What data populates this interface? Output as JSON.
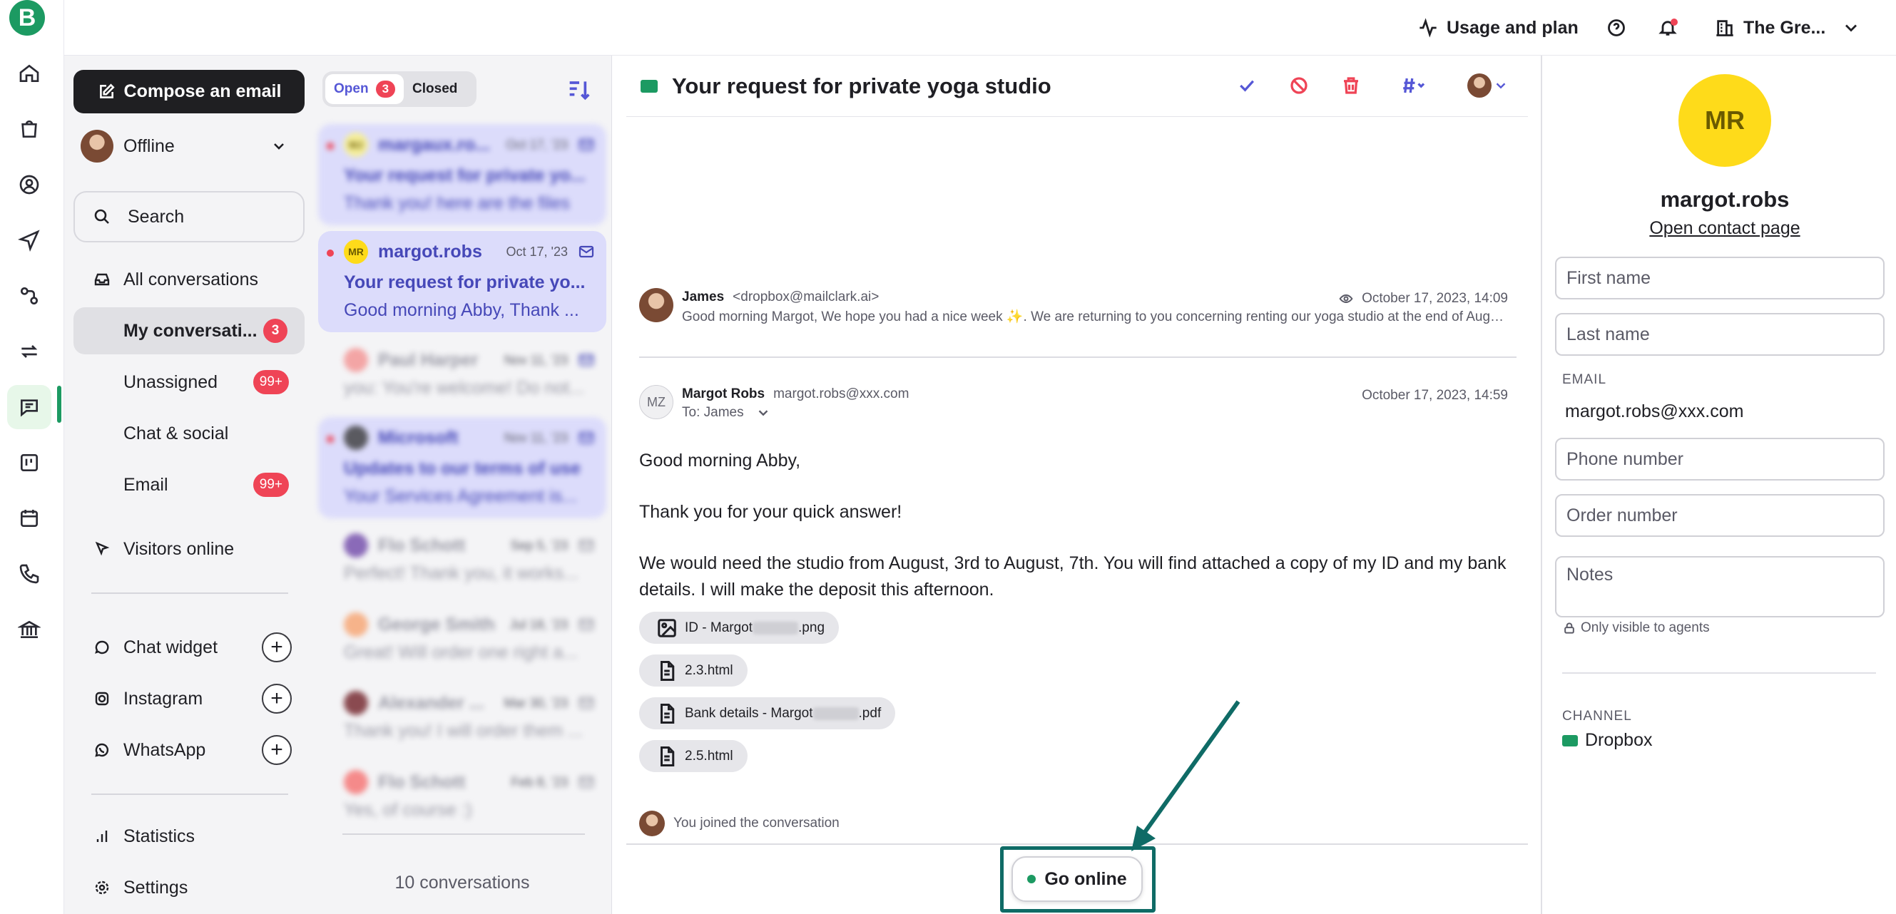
{
  "header": {
    "usage": "Usage and plan",
    "workspace": "The Gre..."
  },
  "leftnav": {
    "compose": "Compose an email",
    "status": "Offline",
    "search": "Search",
    "all": "All conversations",
    "mine": "My conversati...",
    "mine_count": "3",
    "unassigned": "Unassigned",
    "unassigned_count": "99+",
    "chat_social": "Chat & social",
    "email": "Email",
    "email_count": "99+",
    "visitors": "Visitors online",
    "chat_widget": "Chat widget",
    "instagram": "Instagram",
    "whatsapp": "WhatsApp",
    "statistics": "Statistics",
    "settings": "Settings",
    "plus": "+"
  },
  "convlist": {
    "tab_open": "Open",
    "tab_open_count": "3",
    "tab_closed": "Closed",
    "footer": "10 conversations",
    "items": [
      {
        "av": "MJ",
        "name": "margaux.ro...",
        "date": "Oct 17, '23",
        "subject": "Your request for private yo...",
        "preview": "Thank you! here are the files",
        "avcolor": "#f6ef9a"
      },
      {
        "av": "MR",
        "name": "margot.robs",
        "date": "Oct 17, '23",
        "subject": "Your request for private yo...",
        "preview": "Good morning Abby, Thank ...",
        "avcolor": "#fedb1a"
      },
      {
        "av": "",
        "name": "Paul Harper",
        "date": "Nov 11, '23",
        "subject": "",
        "preview": "you: You're welcome! Do not...",
        "avcolor": "#f3a5a5"
      },
      {
        "av": "",
        "name": "Microsoft",
        "date": "Nov 11, '23",
        "subject": "Updates to our terms of use",
        "preview": "Your Services Agreement is...",
        "avcolor": "#5a5a60"
      },
      {
        "av": "",
        "name": "Flo Schott",
        "date": "Sep 5, '23",
        "subject": "",
        "preview": "Perfect! Thank you, it works...",
        "avcolor": "#8a6ab8"
      },
      {
        "av": "",
        "name": "George Smith",
        "date": "Jul 18, '23",
        "subject": "",
        "preview": "Great! Will order one right a...",
        "avcolor": "#f6b38a"
      },
      {
        "av": "",
        "name": "Alexander ...",
        "date": "Mar 30, '23",
        "subject": "",
        "preview": "Thank you! I will order them ...",
        "avcolor": "#8a4a50"
      },
      {
        "av": "",
        "name": "Flo Schott",
        "date": "Feb 8, '23",
        "subject": "",
        "preview": "Yes, of course :)",
        "avcolor": "#f58a8a"
      }
    ]
  },
  "main": {
    "subject": "Your request for private yoga studio",
    "msg1": {
      "name": "James",
      "email": "<dropbox@mailclark.ai>",
      "date": "October 17, 2023, 14:09",
      "snippet": "Good morning Margot,  We hope you had a nice week ✨.  We are returning to you concerning renting our yoga studio at the end of August. As discussed, we need your ID and bank details."
    },
    "msg2": {
      "initials": "MZ",
      "name": "Margot Robs",
      "email": "margot.robs@xxx.com",
      "to": "To: James",
      "date": "October 17, 2023, 14:59",
      "greeting": "Good morning Abby,",
      "line1": "Thank you for your quick answer!",
      "line2": "We would need the studio from August, 3rd to August, 7th. You will find attached a copy of my ID and my bank details. I will make the deposit this afternoon."
    },
    "attachments": [
      {
        "pre": "ID - Margot",
        "post": ".png",
        "blur": true,
        "kind": "image"
      },
      {
        "pre": "2.3.html",
        "post": "",
        "blur": false,
        "kind": "file"
      },
      {
        "pre": "Bank details - Margot",
        "post": ".pdf",
        "blur": true,
        "kind": "file"
      },
      {
        "pre": "2.5.html",
        "post": "",
        "blur": false,
        "kind": "file"
      }
    ],
    "joined": "You joined the conversation",
    "go_online": "Go online"
  },
  "contact": {
    "initials": "MR",
    "name": "margot.robs",
    "open_link": "Open contact page",
    "first_name": "First name",
    "last_name": "Last name",
    "email_label": "EMAIL",
    "email_value": "margot.robs@xxx.com",
    "phone": "Phone number",
    "order": "Order number",
    "notes": "Notes",
    "hint": "Only visible to agents",
    "channel_label": "CHANNEL",
    "channel_value": "Dropbox"
  },
  "colors": {
    "brand": "#1c9a62",
    "accent": "#5557d6",
    "badge": "#ef4456",
    "highlight": "#0f6b66"
  }
}
